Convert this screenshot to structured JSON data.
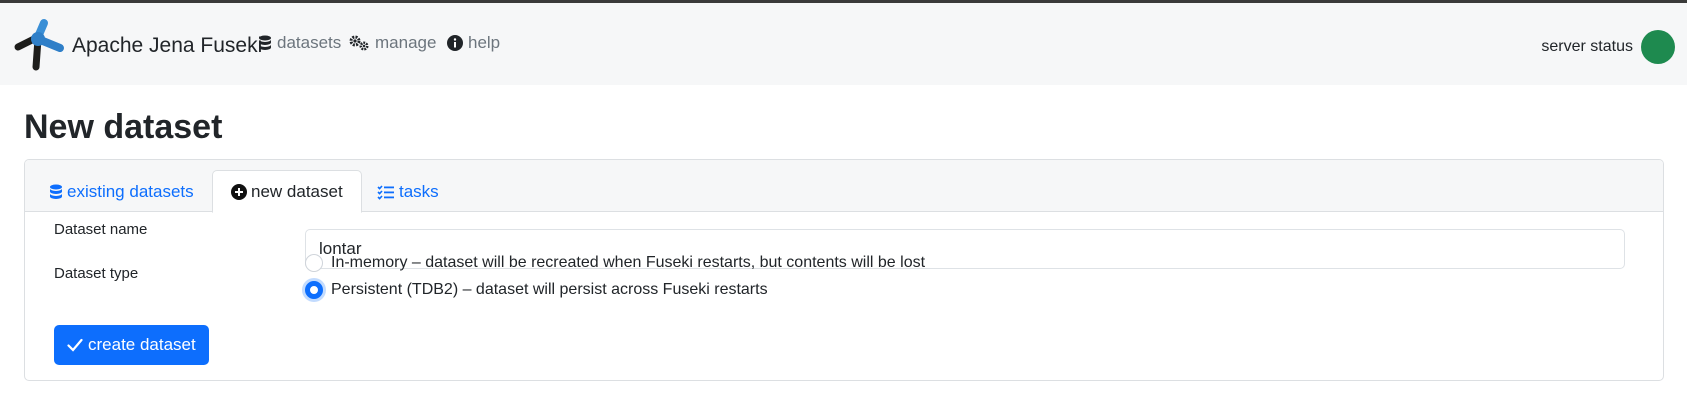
{
  "navbar": {
    "brand": "Apache Jena Fuseki",
    "links": [
      {
        "label": "datasets",
        "icon": "database-icon"
      },
      {
        "label": "manage",
        "icon": "gears-icon"
      },
      {
        "label": "help",
        "icon": "info-icon"
      }
    ],
    "server_status_label": "server status",
    "server_status_color": "#1e8a4f"
  },
  "page": {
    "title": "New dataset"
  },
  "tabs": [
    {
      "label": "existing datasets",
      "icon": "database-icon",
      "active": false
    },
    {
      "label": "new dataset",
      "icon": "plus-circle-icon",
      "active": true
    },
    {
      "label": "tasks",
      "icon": "checklist-icon",
      "active": false
    }
  ],
  "form": {
    "name_label": "Dataset name",
    "name_value": "lontar",
    "type_label": "Dataset type",
    "type_options": [
      {
        "label": "In-memory – dataset will be recreated when Fuseki restarts, but contents will be lost",
        "checked": false
      },
      {
        "label": "Persistent (TDB2) – dataset will persist across Fuseki restarts",
        "checked": true
      }
    ],
    "submit_label": "create dataset"
  },
  "colors": {
    "accent": "#0d6efd",
    "navbar_bg": "#f6f7f8"
  }
}
